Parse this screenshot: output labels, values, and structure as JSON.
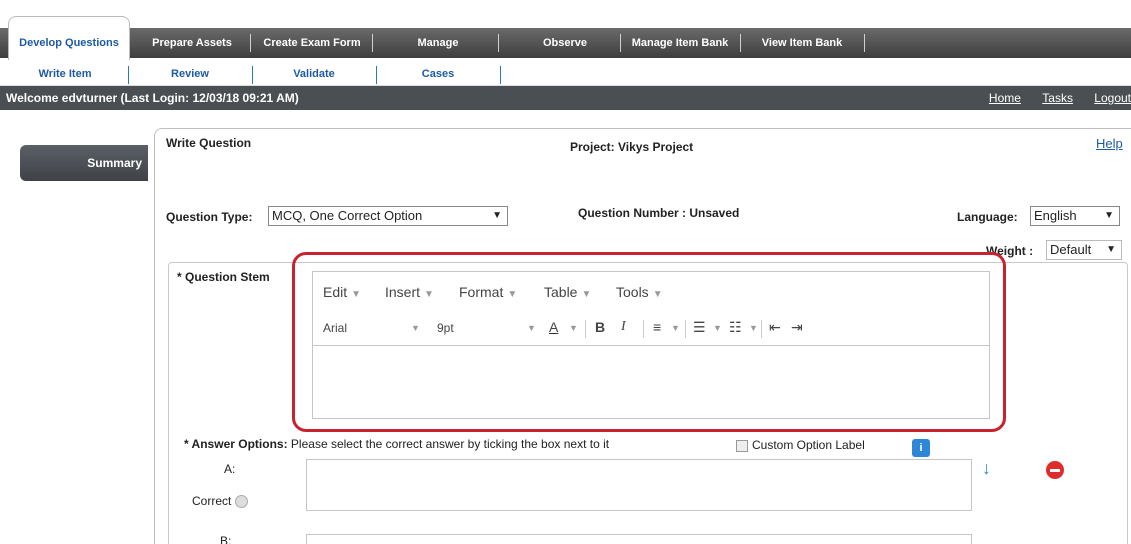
{
  "main_tabs": {
    "develop_questions": "Develop Questions",
    "prepare_assets": "Prepare Assets",
    "create_exam_form": "Create Exam Form",
    "manage": "Manage",
    "observe": "Observe",
    "manage_item_bank": "Manage Item Bank",
    "view_item_bank": "View Item Bank"
  },
  "sub_tabs": {
    "write_item": "Write Item",
    "review": "Review",
    "validate": "Validate",
    "cases": "Cases"
  },
  "welcome": {
    "text": "Welcome edvturner (Last Login: 12/03/18   09:21 AM)",
    "home": "Home",
    "tasks": "Tasks",
    "logout": "Logout"
  },
  "sidebar": {
    "summary": "Summary"
  },
  "panel": {
    "title": "Write Question",
    "project": "Project: Vikys Project",
    "help": "Help",
    "question_type_label": "Question Type:",
    "question_type_value": "MCQ, One Correct Option",
    "question_number_label": "Question Number : Unsaved",
    "language_label": "Language:",
    "language_value": "English",
    "weight_label": "Weight :",
    "weight_value": "Default",
    "question_stem_label": "* Question Stem"
  },
  "editor": {
    "menus": [
      "Edit",
      "Insert",
      "Format",
      "Table",
      "Tools"
    ],
    "font": "Arial",
    "size": "9pt"
  },
  "answers": {
    "label": "* Answer Options:",
    "instruction": "Please select the correct answer by ticking the box next to it",
    "custom_label": "Custom Option Label",
    "option_a": "A:",
    "correct": "Correct",
    "option_b": "B:"
  }
}
